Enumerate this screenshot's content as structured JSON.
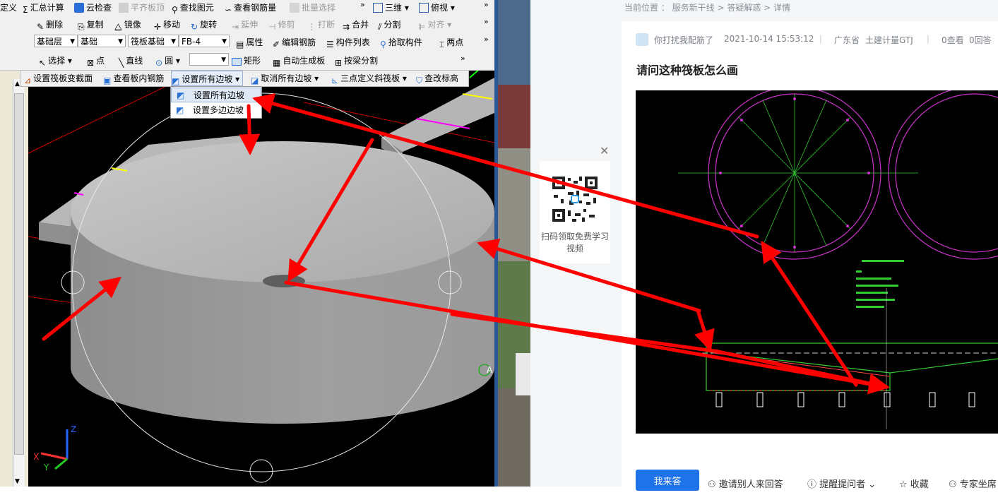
{
  "cad": {
    "toolbar1": {
      "define": "定义",
      "sum_calc": "汇总计算",
      "cloud_check": "云检查",
      "flat_slab_top": "平齐板顶",
      "find_element": "查找图元",
      "view_rebar": "查看钢筋量",
      "batch_select": "批量选择",
      "view_3d": "三维",
      "top_view": "俯视"
    },
    "toolbar2": {
      "delete": "删除",
      "copy": "复制",
      "mirror": "镜像",
      "move": "移动",
      "rotate": "旋转",
      "extend": "延伸",
      "trim": "修剪",
      "break": "打断",
      "merge": "合并",
      "split": "分割",
      "align": "对齐"
    },
    "toolbar3": {
      "layer_value": "基础层",
      "category_value": "基础",
      "type_value": "筏板基础",
      "element_value": "FB-4",
      "properties": "属性",
      "edit_rebar": "编辑钢筋",
      "element_list": "构件列表",
      "pick_element": "拾取构件",
      "two_point": "两点"
    },
    "toolbar4": {
      "select": "选择",
      "point": "点",
      "line": "直线",
      "circle": "圆",
      "rectangle": "矩形",
      "auto_generate": "自动生成板",
      "split_by_beam": "按梁分割"
    },
    "toolbar5": {
      "set_section": "设置筏板变截面",
      "view_inner_rebar": "查看板内钢筋",
      "set_all_slopes": "设置所有边坡",
      "cancel_all_slopes": "取消所有边坡",
      "three_point_slope": "三点定义斜筏板",
      "view_elevation": "查改标高"
    },
    "dropdown_menu": {
      "items": [
        "设置所有边坡",
        "设置多边边坡"
      ]
    },
    "axis_labels": {
      "z": "Z",
      "x": "X",
      "y": "Y"
    },
    "corner_label": "A"
  },
  "browser": {
    "breadcrumb": "当前位置 ： 服务新干线 > 答疑解惑 > 详情",
    "meta": {
      "author": "你打扰我配筋了",
      "datetime": "2021-10-14 15:53:12",
      "region": "广东省",
      "category": "土建计量GTJ",
      "views": "0查看",
      "answers": "0回答"
    },
    "question_title": "请问这种筏板怎么画",
    "qr_caption": "扫码领取免费学习视频",
    "actions": {
      "answer": "我来答",
      "invite": "邀请别人来回答",
      "remind": "提醒提问者",
      "favorite": "收藏",
      "expert": "专家坐席"
    }
  },
  "colors": {
    "cad_background": "#000000",
    "slab_gray": "#a8a8a8",
    "annotation_red": "#ff0000",
    "accent_blue": "#1e73e8",
    "drawing_magenta": "#cc33cc",
    "drawing_green": "#33cc33"
  }
}
